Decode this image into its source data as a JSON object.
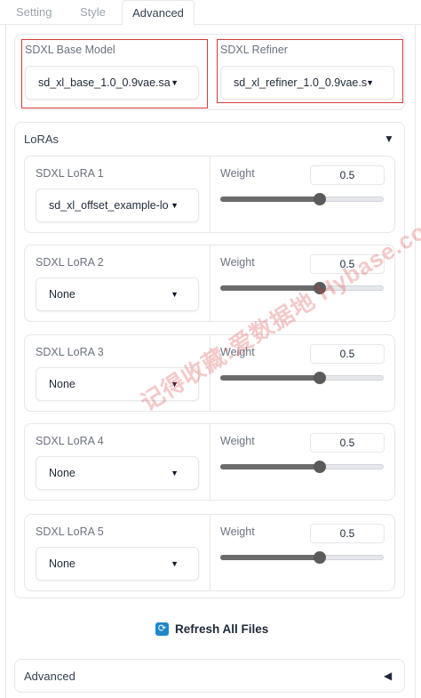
{
  "tabs": [
    {
      "label": "Setting"
    },
    {
      "label": "Style"
    },
    {
      "label": "Advanced",
      "active": true
    }
  ],
  "models": {
    "base_label": "SDXL Base Model",
    "base_value": "sd_xl_base_1.0_0.9vae.sa",
    "refiner_label": "SDXL Refiner",
    "refiner_value": "sd_xl_refiner_1.0_0.9vae.s"
  },
  "loras": {
    "title": "LoRAs",
    "weight_label": "Weight",
    "items": [
      {
        "label": "SDXL LoRA 1",
        "value": "sd_xl_offset_example-lo",
        "weight": "0.5"
      },
      {
        "label": "SDXL LoRA 2",
        "value": "None",
        "weight": "0.5"
      },
      {
        "label": "SDXL LoRA 3",
        "value": "None",
        "weight": "0.5"
      },
      {
        "label": "SDXL LoRA 4",
        "value": "None",
        "weight": "0.5"
      },
      {
        "label": "SDXL LoRA 5",
        "value": "None",
        "weight": "0.5"
      }
    ],
    "slider_fraction": 0.61
  },
  "refresh_label": "Refresh All Files",
  "advanced_title": "Advanced",
  "watermark": "记得收藏:爱数据地 Hybase.com",
  "colors": {
    "highlight_box": "#d33b3b",
    "refresh_icon": "#1e88c7",
    "slider_fill": "#6b6b6b"
  },
  "icons": {
    "dropdown": "caret-down-icon",
    "accordion_open": "triangle-down-icon",
    "accordion_closed": "triangle-left-icon",
    "refresh": "refresh-icon"
  }
}
